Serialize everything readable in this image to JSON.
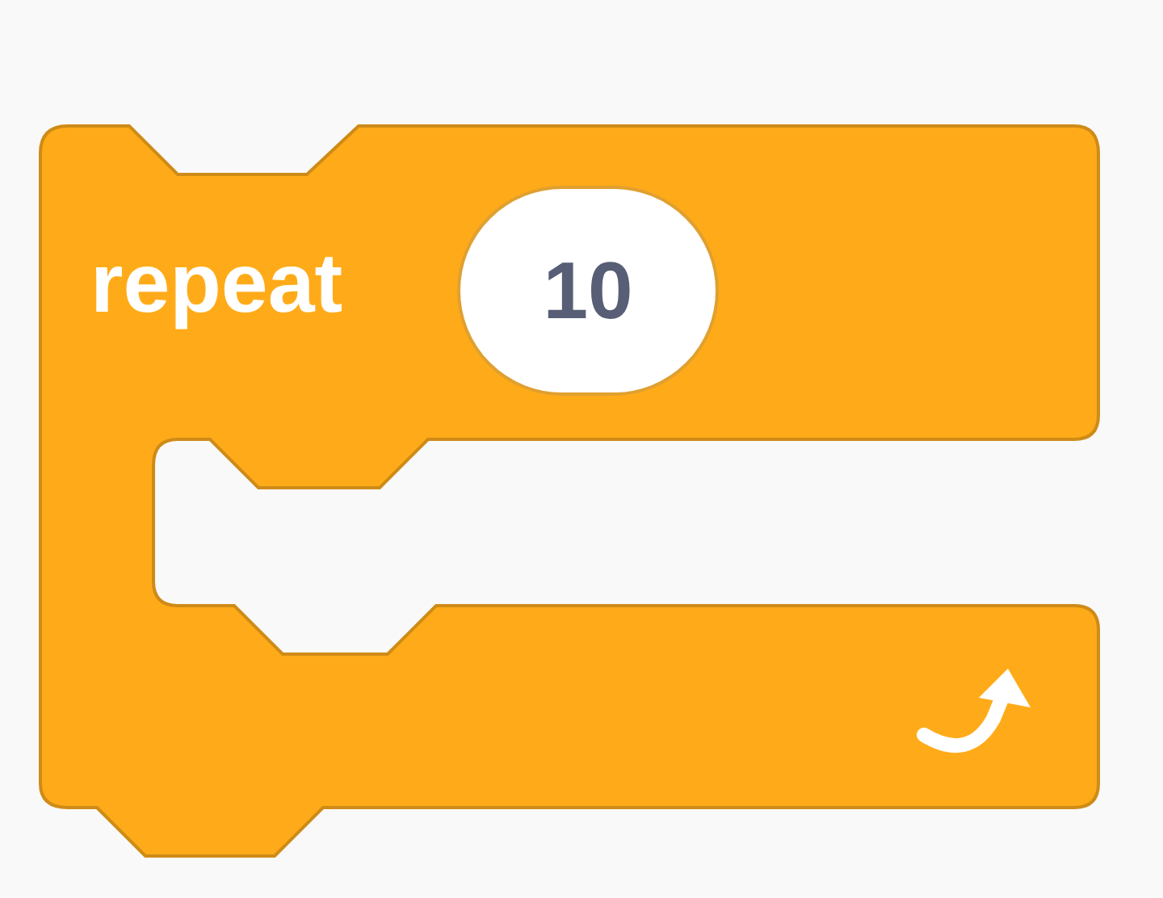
{
  "block": {
    "label": "repeat",
    "input": "10"
  }
}
